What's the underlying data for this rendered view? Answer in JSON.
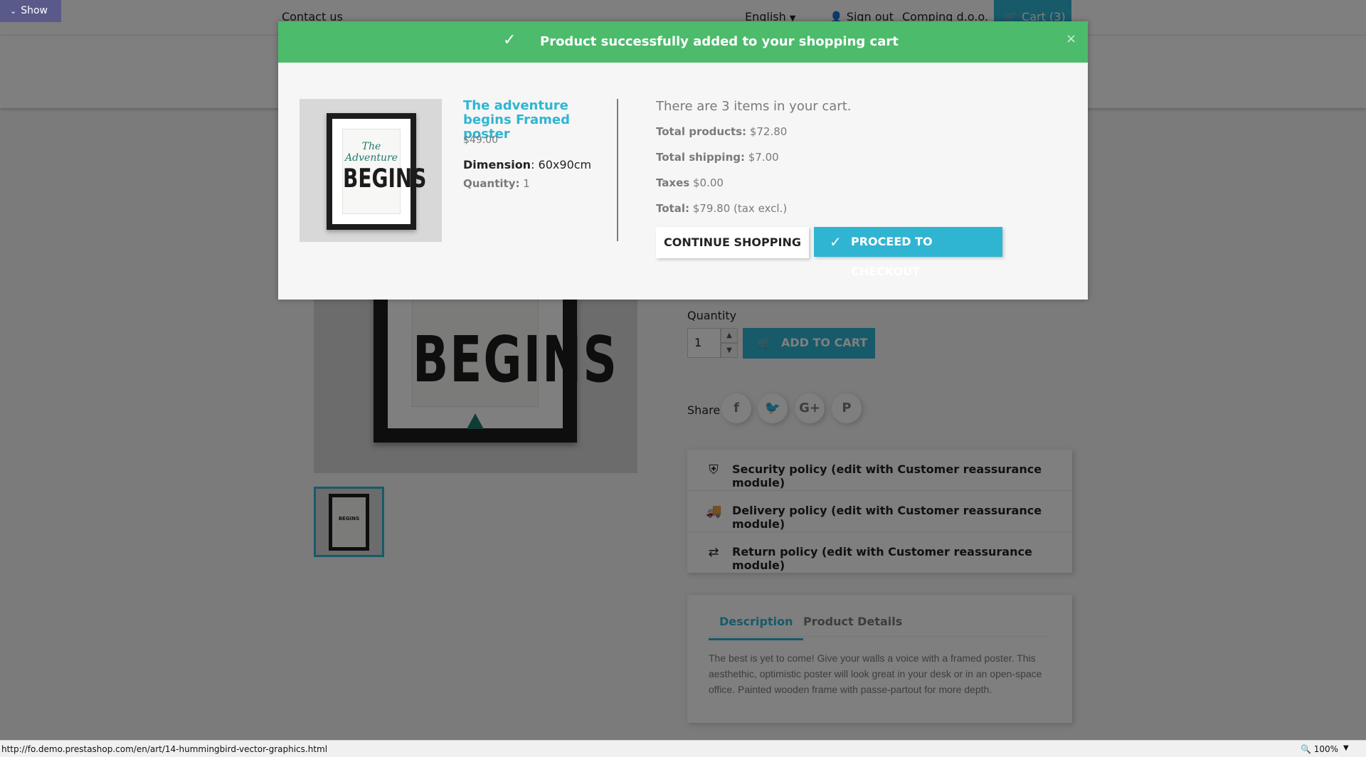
{
  "show_button": {
    "label": "Show"
  },
  "header": {
    "contact_us": "Contact us",
    "language": "English",
    "sign_out": "Sign out",
    "account_name": "Comping d.o.o.",
    "cart_label": "Cart (3)"
  },
  "product_page": {
    "quantity_label": "Quantity",
    "quantity_value": "1",
    "add_to_cart": "ADD TO CART",
    "share_label": "Share",
    "reassurance": [
      {
        "icon": "shield-icon",
        "text": "Security policy (edit with Customer reassurance module)"
      },
      {
        "icon": "truck-icon",
        "text": "Delivery policy (edit with Customer reassurance module)"
      },
      {
        "icon": "swap-arrows-icon",
        "text": "Return policy (edit with Customer reassurance module)"
      }
    ],
    "tabs": [
      {
        "label": "Description",
        "active": true
      },
      {
        "label": "Product Details",
        "active": false
      }
    ],
    "description": "The best is yet to come! Give your walls a voice with a framed poster. This aesthethic, optimistic poster will look great in your desk or in an open-space office. Painted wooden frame with passe-partout for more depth.",
    "poster_text": "BEGINS",
    "thumb_text": "BEGINS"
  },
  "modal": {
    "header_title": "Product successfully added to your shopping cart",
    "close": "×",
    "product_name": "The adventure begins Framed poster",
    "price": "$49.00",
    "dimension_label": "Dimension",
    "dimension_value": ": 60x90cm",
    "quantity_label": "Quantity:",
    "quantity_value": " 1",
    "poster_the": "The Adventure",
    "poster_begins": "BEGINS",
    "cart_count": "There are 3 items in your cart.",
    "total_products_label": "Total products:",
    "total_products_value": " $72.80",
    "total_shipping_label": "Total shipping:",
    "total_shipping_value": " $7.00",
    "taxes_label": "Taxes",
    "taxes_value": " $0.00",
    "total_label": "Total:",
    "total_value": " $79.80 (tax excl.)",
    "continue_shopping": "CONTINUE SHOPPING",
    "proceed_checkout": "PROCEED TO CHECKOUT"
  },
  "statusbar": {
    "url": "http://fo.demo.prestashop.com/en/art/14-hummingbird-vector-graphics.html",
    "zoom": "100%"
  },
  "colors": {
    "accent": "#2fb5d2",
    "success": "#4cbb6c",
    "overlay": "rgba(0,0,0,0.5)"
  }
}
